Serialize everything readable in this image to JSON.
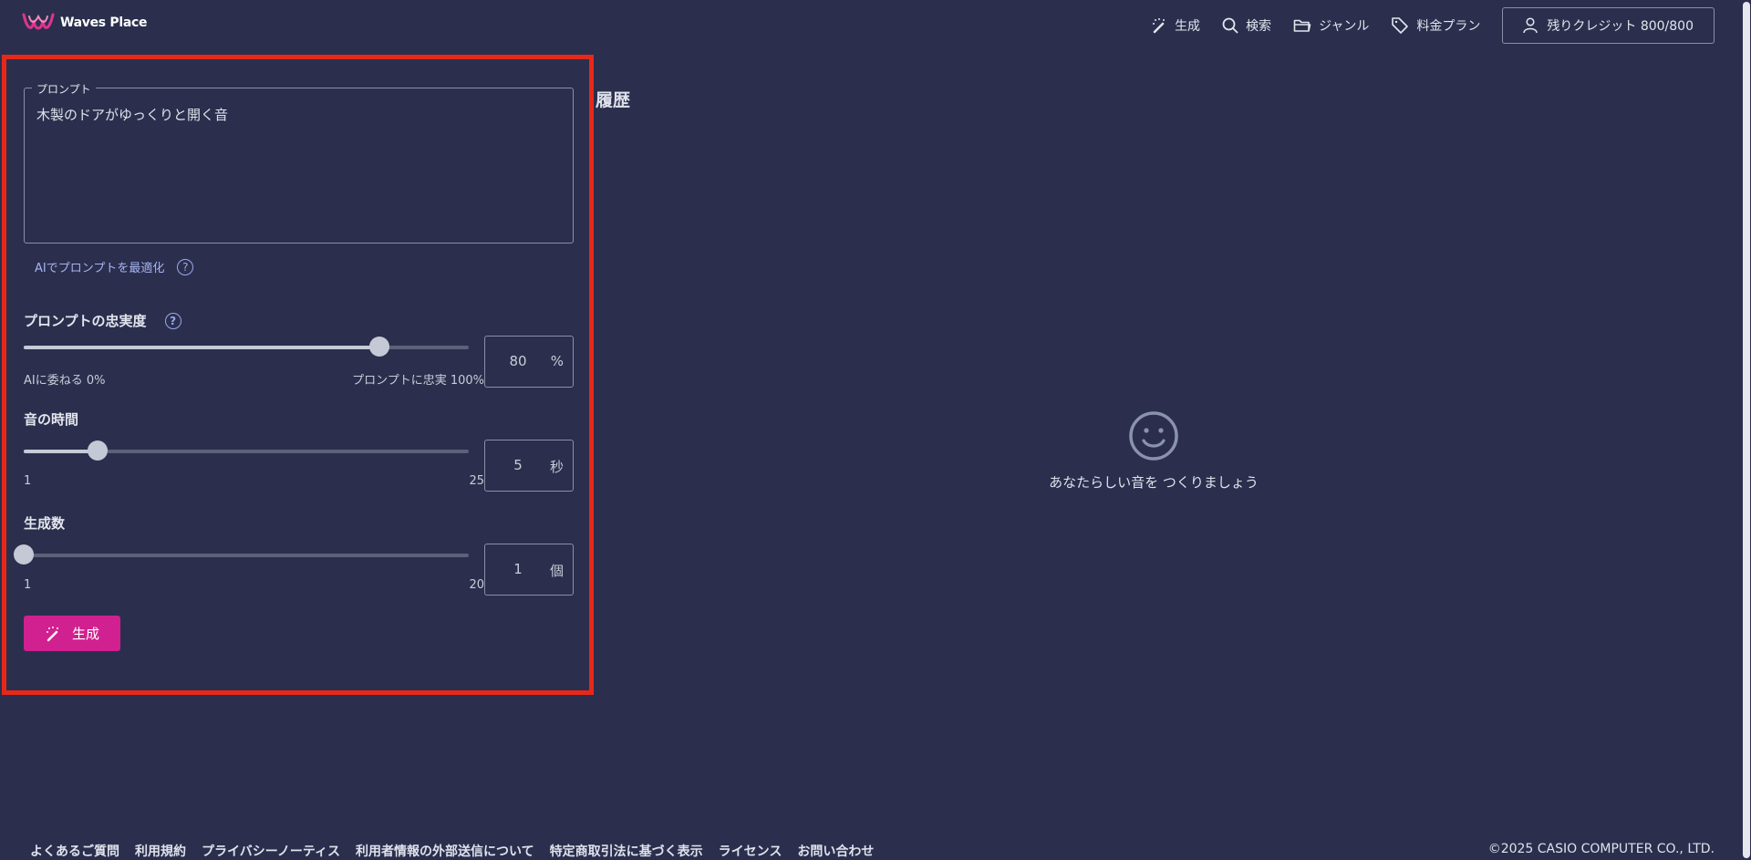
{
  "app": {
    "logo_text": "Waves Place"
  },
  "header": {
    "nav": [
      {
        "label": "生成",
        "icon": "magic-wand-icon"
      },
      {
        "label": "検索",
        "icon": "search-icon"
      },
      {
        "label": "ジャンル",
        "icon": "folder-icon"
      },
      {
        "label": "料金プラン",
        "icon": "tag-icon"
      }
    ],
    "credit_label": "残りクレジット 800/800"
  },
  "form": {
    "prompt_label": "プロンプト",
    "prompt_value": "木製のドアがゆっくりと開く音",
    "optimize_label": "AIでプロンプトを最適化",
    "help_glyph": "?",
    "fidelity": {
      "label": "プロンプトの忠実度",
      "value": 80,
      "min": 0,
      "max": 100,
      "min_label": "AIに委ねる 0%",
      "max_label": "プロンプトに忠実 100%",
      "unit": "%",
      "value_text": "80"
    },
    "duration": {
      "label": "音の時間",
      "value": 5,
      "min": 1,
      "max": 25,
      "min_label": "1",
      "max_label": "25",
      "unit": "秒",
      "value_text": "5"
    },
    "count": {
      "label": "生成数",
      "value": 1,
      "min": 1,
      "max": 20,
      "min_label": "1",
      "max_label": "20",
      "unit": "個",
      "value_text": "1"
    },
    "generate_label": "生成"
  },
  "history": {
    "title": "履歴",
    "empty_message": "あなたらしい音を つくりましょう"
  },
  "footer": {
    "links": [
      "よくあるご質問",
      "利用規約",
      "プライバシーノーティス",
      "利用者情報の外部送信について",
      "特定商取引法に基づく表示",
      "ライセンス",
      "お問い合わせ"
    ],
    "copyright": "©2025 CASIO COMPUTER CO., LTD."
  },
  "colors": {
    "background": "#2b2f4d",
    "accent": "#d1208f",
    "highlight_border": "#e6281a",
    "link": "#a6b4f2"
  }
}
